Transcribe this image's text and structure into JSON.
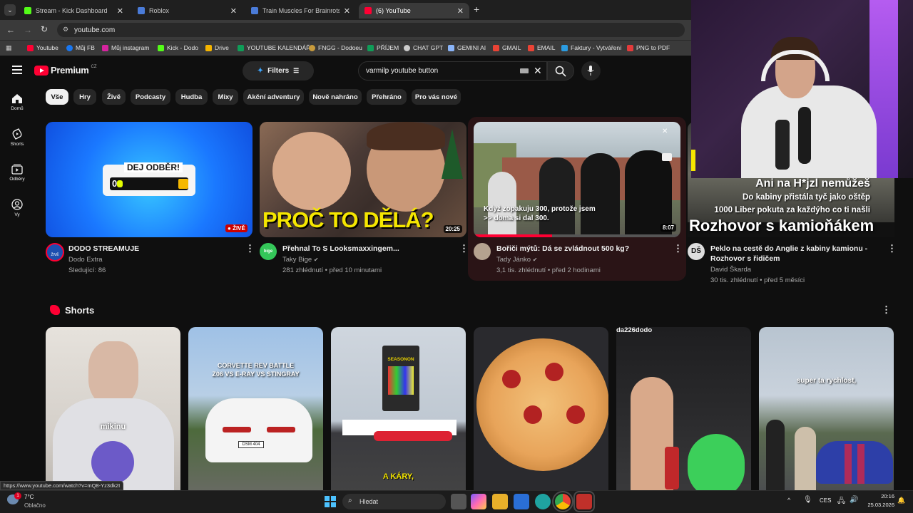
{
  "tabs": [
    {
      "title": "Stream - Kick Dashboard"
    },
    {
      "title": "Roblox"
    },
    {
      "title": "Train Muscles For Brainrots"
    },
    {
      "title": "(6) YouTube"
    }
  ],
  "address": {
    "url": "youtube.com"
  },
  "bookmarks": [
    "Youtube",
    "Můj FB",
    "Můj instagram",
    "Kick - Dodo",
    "Drive",
    "YOUTUBE KALENDÁŘ",
    "FNGG - Dodoeu",
    "PŘÍJEM",
    "CHAT GPT",
    "GEMINI AI",
    "GMAIL",
    "EMAIL",
    "Faktury - Vytváření",
    "PNG to PDF"
  ],
  "youtube": {
    "logo": "Premium",
    "region": "CZ",
    "filters_label": "Filters",
    "search_value": "varmilp youtube button",
    "sidebar": [
      {
        "label": "Domů",
        "icon": "home-icon"
      },
      {
        "label": "Shorts",
        "icon": "shorts-icon"
      },
      {
        "label": "Odběry",
        "icon": "subscriptions-icon"
      },
      {
        "label": "Vy",
        "icon": "you-icon"
      }
    ],
    "chips": [
      "Vše",
      "Hry",
      "Živě",
      "Podcasty",
      "Hudba",
      "Mixy",
      "Akční adventury",
      "Nově nahráno",
      "Přehráno",
      "Pro vás nové"
    ],
    "videos": [
      {
        "title": "DODO STREAMUJE",
        "channel": "Dodo Extra",
        "stats": "Sledující: 86",
        "badge": "ŽIVĚ",
        "thumb_text": "DEJ ODBĚR!",
        "thumb_counter": "0",
        "avatar_label": "ŽIVĚ"
      },
      {
        "title": "Přehnal To S Looksmaxxingem...",
        "channel": "Taky Bige",
        "stats": "281 zhlédnutí • před 10 minutami",
        "duration": "20:25",
        "thumb_text": "PROČ TO DĚLÁ?",
        "avatar_label": "bige"
      },
      {
        "title": "Bořiči mýtů: Dá se zvládnout 500 kg?",
        "channel": "Tady Jánko",
        "stats": "3,1 tis. zhlédnutí • před 2 hodinami",
        "duration": "8:07",
        "caption": "Když zopakuju 300, protože jsem\n>> doma si dal 300."
      },
      {
        "title": "Peklo na cestě do Anglie z kabiny kamionu -",
        "title2": "Rozhovor s řidičem",
        "channel": "David Škarda",
        "stats": "30 tis. zhlédnutí • před 5 měsíci",
        "overlay_lines": [
          "Ani na H*jzl nemůžeš",
          "Do kabiny přistála tyč jako oštěp",
          "1000 Liber pokuta za každýho co ti našli",
          "Rozhovor s kamioňákem"
        ]
      }
    ],
    "shorts_title": "Shorts",
    "shorts": [
      {
        "caption": "mikinu"
      },
      {
        "caption": "CORVETTE REV BATTLE\nZ06 VS E-RAY VS STINGRAY",
        "plate": "DSM 404"
      },
      {
        "caption": "A KÁRY,",
        "poster": "SEASONON"
      },
      {
        "caption": ""
      },
      {
        "caption": "",
        "channel_label": "da226dodo"
      },
      {
        "caption": "super ta rychlost,"
      }
    ]
  },
  "status_url": "https://www.youtube.com/watch?v=mQ8-Yz3dk2I",
  "taskbar": {
    "temp": "7°C",
    "weather": "Oblačno",
    "notif": "1",
    "search": "Hledat",
    "lang": "CES",
    "time": "20:16",
    "date": "25.03.2026"
  }
}
